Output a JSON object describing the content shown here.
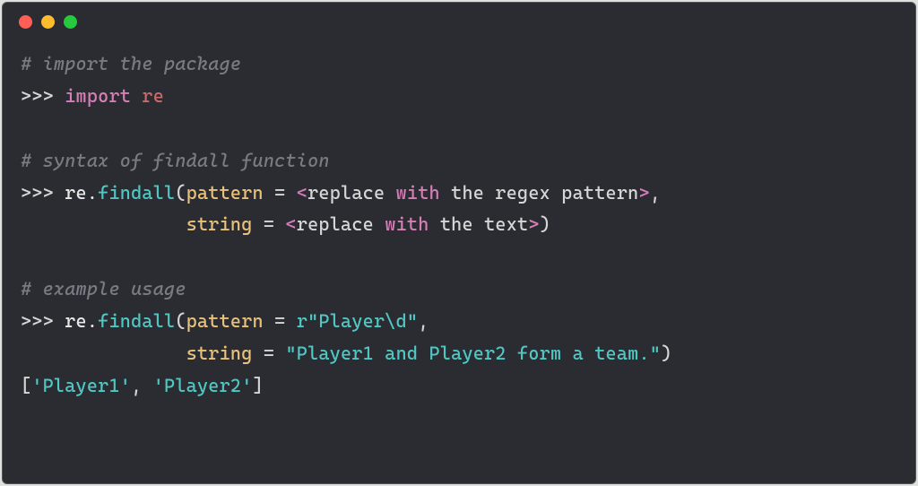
{
  "titlebar": {
    "dots": [
      "red",
      "yellow",
      "green"
    ]
  },
  "code": {
    "c1": "# import the package",
    "p1": ">>> ",
    "kw_import": "import",
    "mod_re": " re",
    "c2": "# syntax of findall function",
    "p2": ">>> ",
    "obj_re": "re",
    "dot": ".",
    "fn_findall": "findall",
    "open_paren": "(",
    "param_pattern": "pattern",
    "eq": " = ",
    "lt": "<",
    "txt_replace1": "replace ",
    "kw_with": "with",
    "txt_rest1": " the regex pattern",
    "gt": ">",
    "comma": ",",
    "indent2": "               ",
    "param_string": "string",
    "txt_replace2": "replace ",
    "txt_rest2": " the text",
    "close_paren": ")",
    "c3": "# example usage",
    "p3": ">>> ",
    "str_pattern": "r\"Player\\d\"",
    "str_text": "\"Player1 and Player2 form a team.\"",
    "out_open": "[",
    "out_s1": "'Player1'",
    "out_sep": ", ",
    "out_s2": "'Player2'",
    "out_close": "]"
  }
}
